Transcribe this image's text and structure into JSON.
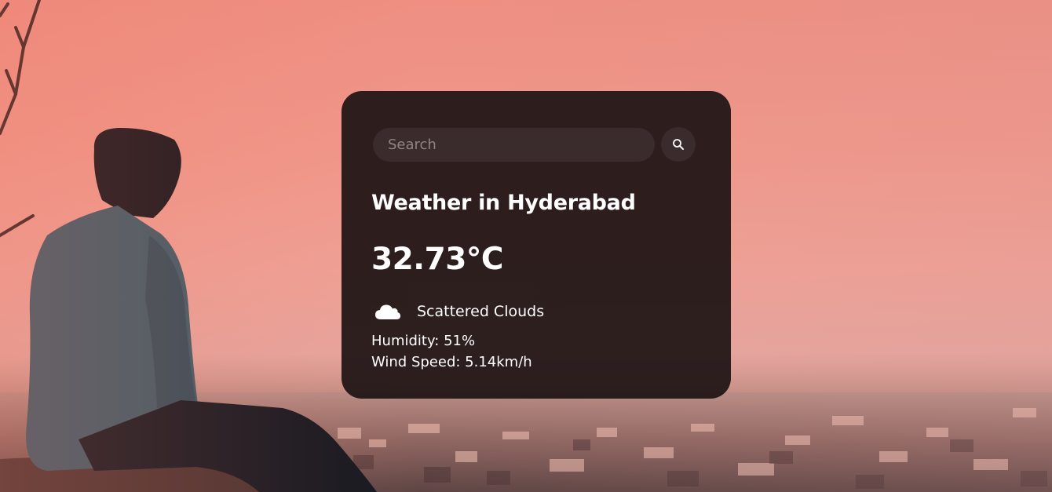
{
  "search": {
    "placeholder": "Search",
    "value": ""
  },
  "weather": {
    "title": "Weather in Hyderabad",
    "temperature": "32.73°C",
    "condition": "Scattered Clouds",
    "condition_icon": "cloud-icon",
    "humidity": "Humidity: 51%",
    "wind_speed": "Wind Speed: 5.14km/h"
  },
  "colors": {
    "card_background": "#1e1414",
    "input_background": "#3a2c2c",
    "text": "#ffffff",
    "sky": "#ee8f82"
  },
  "icons": {
    "search_button": "search-icon",
    "condition": "cloud-icon"
  }
}
